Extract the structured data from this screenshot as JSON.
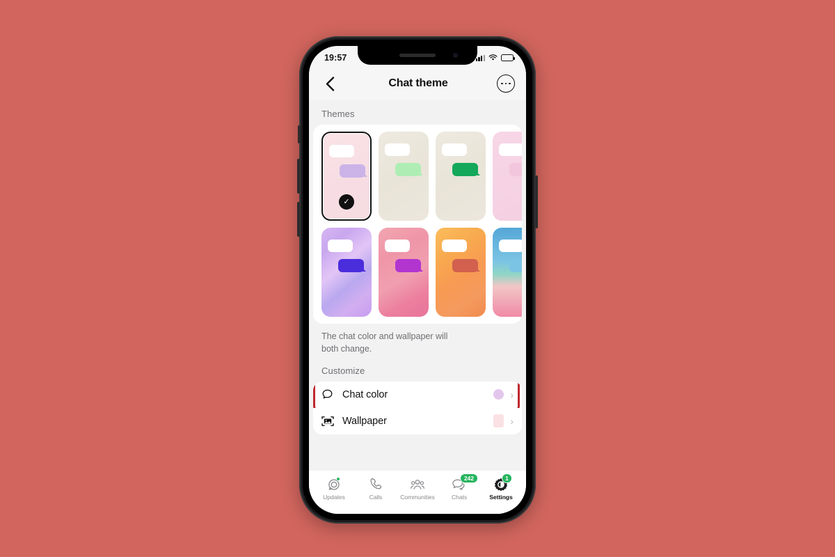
{
  "background_color": "#d2665e",
  "status_bar": {
    "time": "19:57",
    "signal_icon": "cellular-signal-icon",
    "wifi_icon": "wifi-icon",
    "battery_icon": "battery-icon",
    "battery_color": "#f3c31b"
  },
  "nav": {
    "back_icon": "chevron-left-icon",
    "title": "Chat theme",
    "more_icon": "more-options-icon"
  },
  "themes_section": {
    "label": "Themes",
    "helper_text": "The chat color and wallpaper will both change.",
    "rows": [
      [
        {
          "name": "theme-pink-lavender",
          "selected": true,
          "bg": "linear-gradient(160deg,#fae3e6 0%,#f7dde3 55%,#f6dde2 100%)",
          "bubble_out": "#cbb3e8",
          "check": "✓"
        },
        {
          "name": "theme-beige-mint",
          "selected": false,
          "bg": "linear-gradient(150deg,#eeeae0 0%,#e9e4d8 50%,#ece7dd 100%)",
          "bubble_out": "#aeeeb4"
        },
        {
          "name": "theme-beige-green",
          "selected": false,
          "bg": "linear-gradient(150deg,#eeeae0 0%,#e9e4d8 50%,#ece7dd 100%)",
          "bubble_out": "#13a85a"
        },
        {
          "name": "theme-pink-partial",
          "selected": false,
          "bg": "linear-gradient(160deg,#f7d6e6 0%,#f4cfe2 100%)",
          "bubble_out": "#f2c6dd"
        }
      ],
      [
        {
          "name": "theme-holographic-purple",
          "selected": false,
          "bg": "linear-gradient(140deg,#d7b6f2 0%,#c9a7ef 20%,#e2c5f6 42%,#b9a8ef 62%,#d2aef0 80%,#c79cf0 100%)",
          "bubble_out": "#4a2ddb"
        },
        {
          "name": "theme-pink-floral",
          "selected": false,
          "bg": "linear-gradient(150deg,#f2a6b0 0%,#ef96a8 28%,#f09fb0 55%,#ec7f9e 78%,#e8749a 100%)",
          "bubble_out": "#b235cf"
        },
        {
          "name": "theme-orange-silk",
          "selected": false,
          "bg": "linear-gradient(145deg,#fbbd5c 0%,#f8a94e 30%,#f79a53 55%,#f59a5f 78%,#f08a4e 100%)",
          "bubble_out": "#d1604f"
        },
        {
          "name": "theme-beach-partial",
          "selected": false,
          "bg": "linear-gradient(180deg,#55a7d8 0%,#7cc4e3 38%,#8fd6c6 52%,#f2c6c6 66%,#f08aa6 100%)",
          "bubble_out": "#7cc4e3"
        }
      ]
    ]
  },
  "customize_section": {
    "label": "Customize",
    "rows": [
      {
        "name": "chat-color",
        "icon": "chat-bubble-icon",
        "label": "Chat color",
        "swatch_shape": "circle",
        "swatch_color": "#e3c6ec",
        "chevron": "›",
        "highlighted": true
      },
      {
        "name": "wallpaper",
        "icon": "photo-icon",
        "label": "Wallpaper",
        "swatch_shape": "square",
        "swatch_color": "#fae2e4",
        "chevron": "›",
        "highlighted": false
      }
    ]
  },
  "highlight": {
    "color": "#c0272d"
  },
  "tab_bar": {
    "accent_color": "#25b45e",
    "tabs": [
      {
        "name": "tab-updates",
        "icon": "updates-icon",
        "label": "Updates",
        "badge": "",
        "dot": true,
        "active": false
      },
      {
        "name": "tab-calls",
        "icon": "phone-icon",
        "label": "Calls",
        "badge": "",
        "dot": false,
        "active": false
      },
      {
        "name": "tab-communities",
        "icon": "communities-icon",
        "label": "Communities",
        "badge": "",
        "dot": false,
        "active": false
      },
      {
        "name": "tab-chats",
        "icon": "chats-icon",
        "label": "Chats",
        "badge": "242",
        "dot": false,
        "active": false
      },
      {
        "name": "tab-settings",
        "icon": "gear-icon",
        "label": "Settings",
        "badge": "1",
        "dot": false,
        "active": true
      }
    ]
  }
}
